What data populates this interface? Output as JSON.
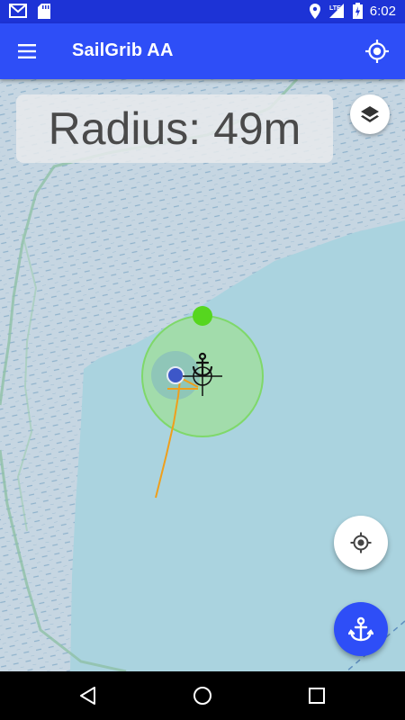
{
  "status_bar": {
    "time": "6:02",
    "network": "LTE",
    "battery_level": "charging",
    "icons": [
      "gmail-icon",
      "sd-card-icon",
      "location-icon",
      "signal-icon",
      "battery-icon"
    ]
  },
  "app_bar": {
    "title": "SailGrib AA",
    "menu_icon": "menu-icon",
    "gps_icon": "gps-fixed-icon"
  },
  "map": {
    "radius_label": "Radius: 49m",
    "anchor_marker": "anchor-icon",
    "colors": {
      "land": "#c9d8e2",
      "deep_water": "#aad3df",
      "alarm_circle": "#7fd86a",
      "drag_handle": "#56d61f",
      "boat_track": "#ef9f1c",
      "boat_position": "#3d57c8"
    }
  },
  "controls": {
    "layers_icon": "layers-icon",
    "locate_icon": "my-location-icon",
    "anchor_button_icon": "anchor-icon"
  },
  "nav_bar": {
    "back_icon": "back-icon",
    "home_icon": "home-icon",
    "recents_icon": "recents-icon"
  }
}
